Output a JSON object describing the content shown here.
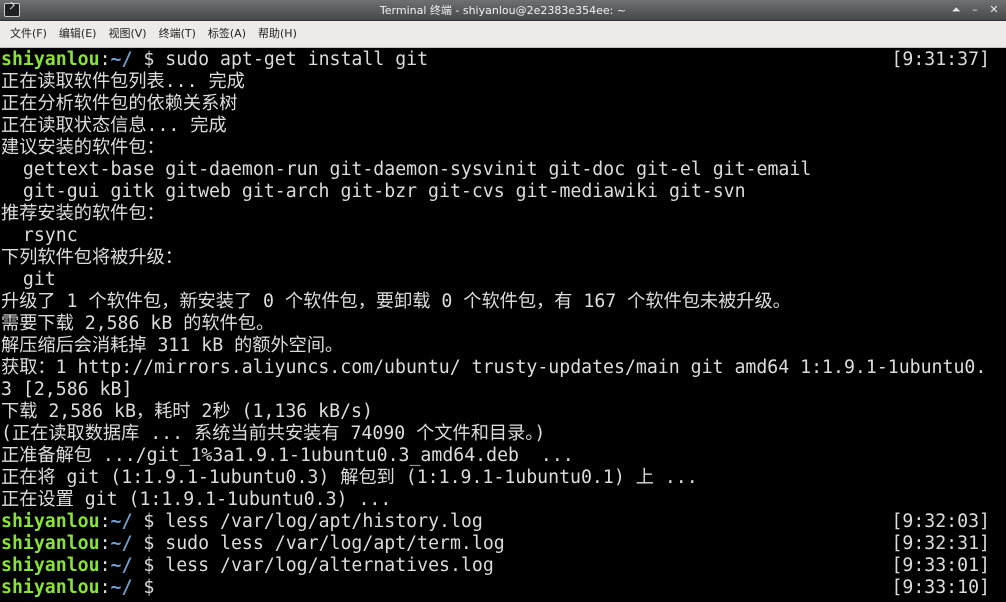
{
  "window": {
    "title": "Terminal 终端 - shiyanlou@2e2383e354ee: ~",
    "buttons": [
      "⏶",
      "–",
      "✕"
    ]
  },
  "menu": {
    "items": [
      "文件(F)",
      "编辑(E)",
      "视图(V)",
      "终端(T)",
      "标签(A)",
      "帮助(H)"
    ]
  },
  "terminal": {
    "prompt": {
      "user_host": "shiyanlou",
      "separator": ":",
      "path": "~/",
      "symbol": " $ "
    },
    "commands": [
      {
        "command": "sudo apt-get install git",
        "timestamp": "[9:31:37]"
      },
      {
        "command": "less /var/log/apt/history.log",
        "timestamp": "[9:32:03]"
      },
      {
        "command": "sudo less /var/log/apt/term.log",
        "timestamp": "[9:32:31]"
      },
      {
        "command": "less /var/log/alternatives.log",
        "timestamp": "[9:33:01]"
      },
      {
        "command": "",
        "timestamp": "[9:33:10]"
      }
    ],
    "output_lines": [
      "正在读取软件包列表... 完成",
      "正在分析软件包的依赖关系树",
      "正在读取状态信息... 完成",
      "建议安装的软件包：",
      "  gettext-base git-daemon-run git-daemon-sysvinit git-doc git-el git-email",
      "  git-gui gitk gitweb git-arch git-bzr git-cvs git-mediawiki git-svn",
      "推荐安装的软件包：",
      "  rsync",
      "下列软件包将被升级：",
      "  git",
      "升级了 1 个软件包，新安装了 0 个软件包，要卸载 0 个软件包，有 167 个软件包未被升级。",
      "需要下载 2,586 kB 的软件包。",
      "解压缩后会消耗掉 311 kB 的额外空间。",
      "获取：1 http://mirrors.aliyuncs.com/ubuntu/ trusty-updates/main git amd64 1:1.9.1-1ubuntu0.",
      "3 [2,586 kB]",
      "下载 2,586 kB，耗时 2秒 (1,136 kB/s)",
      "(正在读取数据库 ... 系统当前共安装有 74090 个文件和目录。)",
      "正准备解包 .../git_1%3a1.9.1-1ubuntu0.3_amd64.deb  ...",
      "正在将 git (1:1.9.1-1ubuntu0.3) 解包到 (1:1.9.1-1ubuntu0.1) 上 ...",
      "正在设置 git (1:1.9.1-1ubuntu0.3) ..."
    ]
  }
}
